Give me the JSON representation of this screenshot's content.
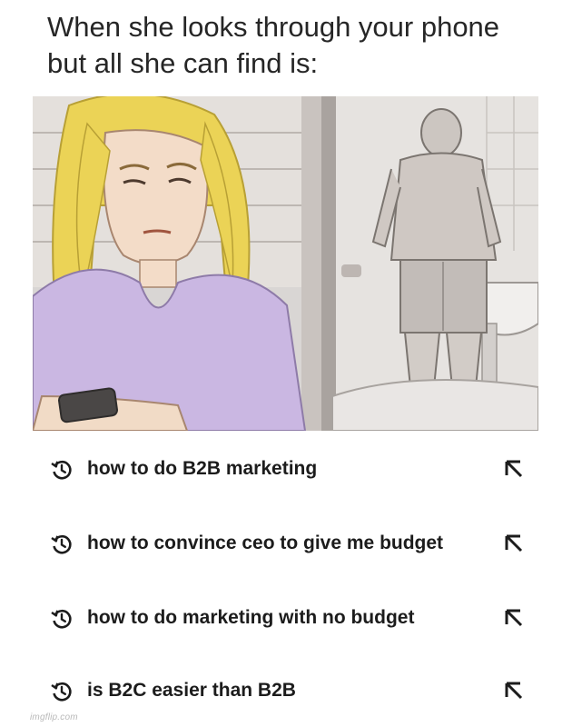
{
  "caption": "When she looks through your phone but all she can find is:",
  "search_history": [
    {
      "text": "how to do B2B marketing",
      "icon": "history-icon",
      "action_icon": "fill-arrow-icon"
    },
    {
      "text": "how to convince ceo to give me budget",
      "icon": "history-icon",
      "action_icon": "fill-arrow-icon"
    },
    {
      "text": "how to do marketing with no budget",
      "icon": "history-icon",
      "action_icon": "fill-arrow-icon"
    },
    {
      "text": "is B2C easier than B2B",
      "icon": "history-icon",
      "action_icon": "fill-arrow-icon"
    }
  ],
  "watermark": "imgflip.com",
  "colors": {
    "background": "#ffffff",
    "text": "#1c1c1c",
    "hair": "#e9d24c",
    "shirt": "#c9b5e0",
    "skin": "#f2dcc8",
    "wall": "#d7d4d2"
  }
}
